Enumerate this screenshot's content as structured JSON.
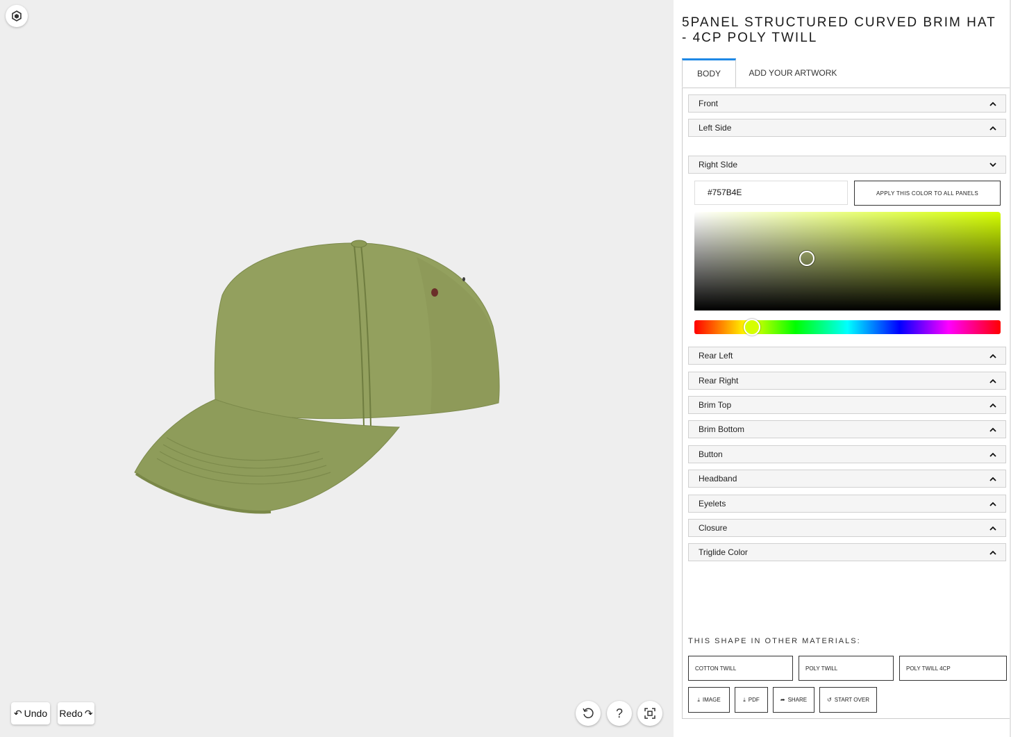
{
  "viewer": {
    "logo_icon": "cube-logo-icon",
    "hat_color": "#757B4E",
    "undo_label": "Undo",
    "redo_label": "Redo",
    "tools": [
      "reset-view-icon",
      "help-icon",
      "fullscreen-icon"
    ],
    "help_glyph": "?"
  },
  "panel": {
    "title": "5PANEL STRUCTURED CURVED BRIM HAT - 4CP POLY TWILL",
    "tabs": [
      {
        "label": "BODY",
        "active": true
      },
      {
        "label": "ADD YOUR ARTWORK",
        "active": false
      }
    ],
    "sections": [
      {
        "label": "Front",
        "expanded": false
      },
      {
        "label": "Left Side",
        "expanded": false
      },
      {
        "label": "Right SIde",
        "expanded": true
      },
      {
        "label": "Rear Left",
        "expanded": false
      },
      {
        "label": "Rear Right",
        "expanded": false
      },
      {
        "label": "Brim Top",
        "expanded": false
      },
      {
        "label": "Brim Bottom",
        "expanded": false
      },
      {
        "label": "Button",
        "expanded": false
      },
      {
        "label": "Headband",
        "expanded": false
      },
      {
        "label": "Eyelets",
        "expanded": false
      },
      {
        "label": "Closure",
        "expanded": false
      },
      {
        "label": "Triglide Color",
        "expanded": false
      }
    ],
    "color_picker": {
      "hex_value": "#757B4E",
      "apply_label": "APPLY THIS COLOR TO ALL PANELS",
      "hue_color": "#D5FF00"
    },
    "materials_label": "THIS SHAPE IN OTHER MATERIALS:",
    "materials": [
      "COTTON TWILL",
      "POLY TWILL",
      "POLY TWILL 4CP"
    ],
    "actions": {
      "image": "IMAGE",
      "pdf": "PDF",
      "share": "SHARE",
      "start_over": "START OVER"
    },
    "accent_color": "#1e88e5"
  }
}
